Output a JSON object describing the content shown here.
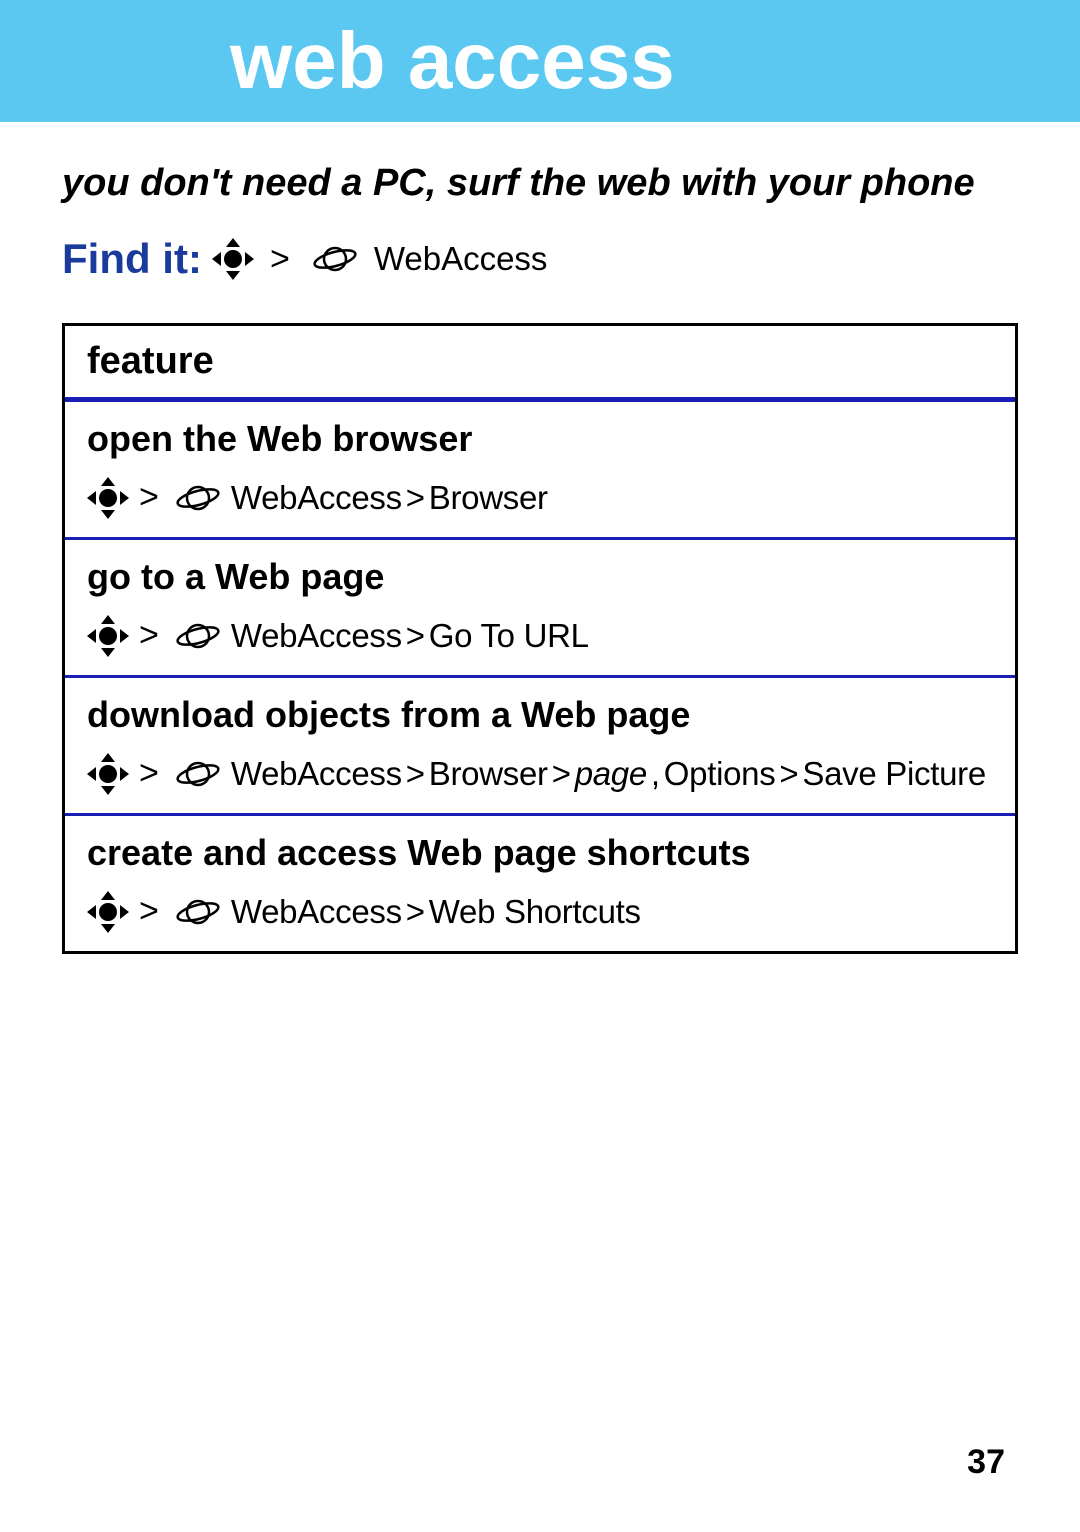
{
  "header": {
    "title": "web access"
  },
  "subtitle": "you don't need a PC, surf the web with your phone",
  "find_it": {
    "label": "Find it:",
    "separator": ">",
    "path_label": "WebAccess"
  },
  "table": {
    "header": "feature",
    "rows": [
      {
        "title": "open the Web browser",
        "path_before": "WebAccess",
        "gt1": ">",
        "path_after": "Browser"
      },
      {
        "title": "go to a Web page",
        "path_before": "WebAccess",
        "gt1": ">",
        "path_after": "Go To URL"
      },
      {
        "title": "download objects from a Web page",
        "path_1": "WebAccess",
        "gt1": ">",
        "path_2": "Browser",
        "gt2": ">",
        "path_italic": "page",
        "comma": ", ",
        "path_3": "Options",
        "gt3": ">",
        "path_4": "Save Picture"
      },
      {
        "title": "create and access Web page shortcuts",
        "path_before": "WebAccess",
        "gt1": ">",
        "path_after": "Web Shortcuts"
      }
    ]
  },
  "page_number": "37"
}
